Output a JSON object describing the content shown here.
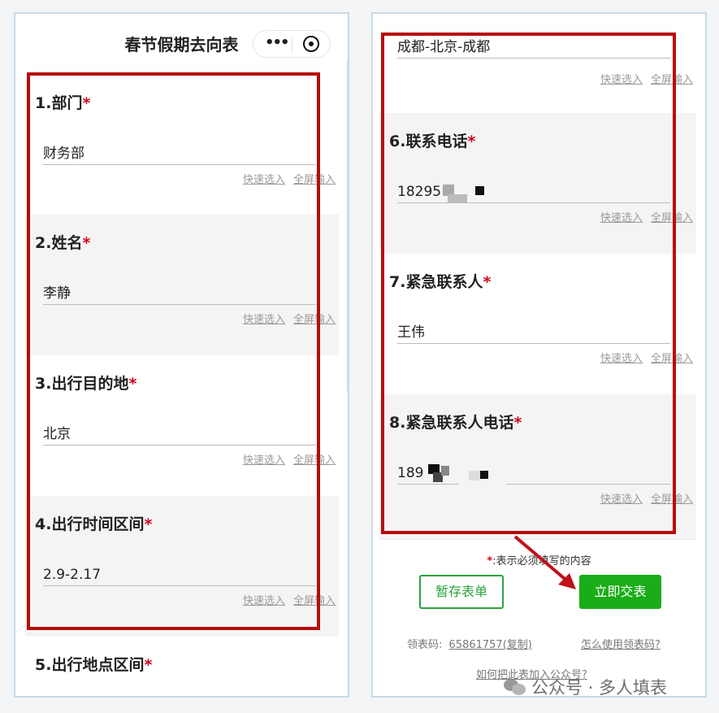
{
  "left": {
    "title": "春节假期去向表",
    "questions": [
      {
        "label": "1.部门",
        "required_mark": "*",
        "value": "财务部",
        "quick_select": "快速选入",
        "fullscreen": "全屏输入"
      },
      {
        "label": "2.姓名",
        "required_mark": "*",
        "value": "李静",
        "quick_select": "快速选入",
        "fullscreen": "全屏输入"
      },
      {
        "label": "3.出行目的地",
        "required_mark": "*",
        "value": "北京",
        "quick_select": "快速选入",
        "fullscreen": "全屏输入"
      },
      {
        "label": "4.出行时间区间",
        "required_mark": "*",
        "value": "2.9-2.17",
        "quick_select": "快速选入",
        "fullscreen": "全屏输入"
      },
      {
        "label": "5.出行地点区间",
        "required_mark": "*"
      }
    ]
  },
  "right": {
    "top_value": "成都-北京-成都",
    "top_quick_select": "快速选入",
    "top_fullscreen": "全屏输入",
    "questions": [
      {
        "label": "6.联系电话",
        "required_mark": "*",
        "value": "18295",
        "quick_select": "快速选入",
        "fullscreen": "全屏输入"
      },
      {
        "label": "7.紧急联系人",
        "required_mark": "*",
        "value": "王伟",
        "quick_select": "快速选入",
        "fullscreen": "全屏输入"
      },
      {
        "label": "8.紧急联系人电话",
        "required_mark": "*",
        "value": "189",
        "quick_select": "快速选入",
        "fullscreen": "全屏输入"
      }
    ],
    "required_note_star": "*",
    "required_note": ":表示必须填写的内容",
    "save_button": "暂存表单",
    "submit_button": "立即交表",
    "code_label": "领表码:",
    "code_value": "65861757(复制)",
    "how_to_use": "怎么使用领表码?",
    "add_to_account": "如何把此表加入公众号?"
  },
  "watermark": "公众号 · 多人填表",
  "colors": {
    "highlight_red": "#b60b0b",
    "required_red": "#d0021b",
    "primary_green": "#1aad19"
  }
}
